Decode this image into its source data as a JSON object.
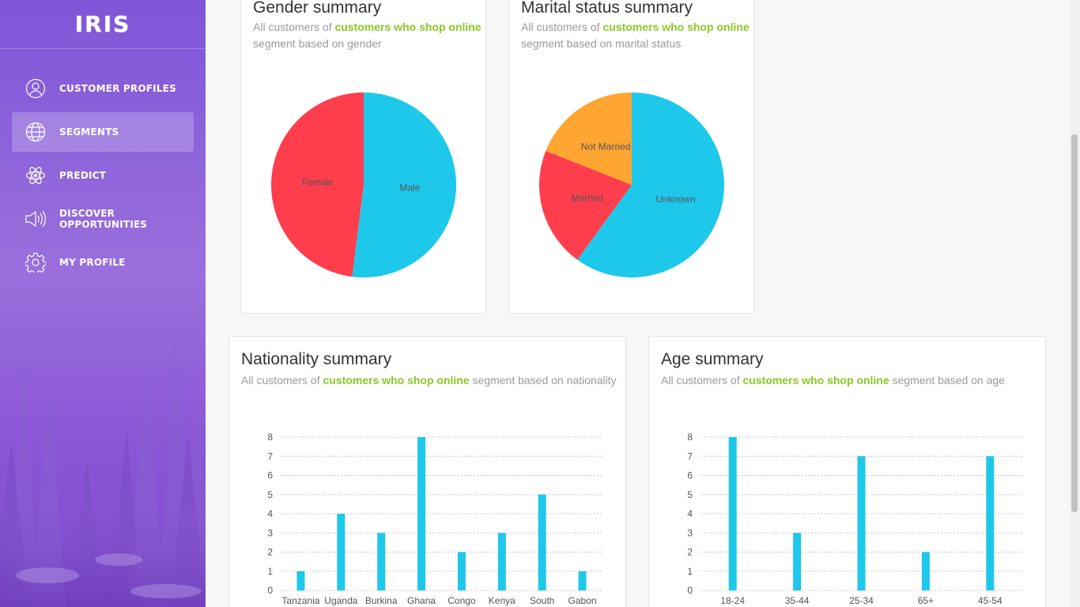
{
  "app": {
    "logo": "IRIS"
  },
  "sidebar": {
    "items": [
      {
        "label": "CUSTOMER PROFILES",
        "icon": "user-icon",
        "active": false
      },
      {
        "label": "SEGMENTS",
        "icon": "globe-icon",
        "active": true
      },
      {
        "label": "PREDICT",
        "icon": "atom-icon",
        "active": false
      },
      {
        "label": "DISCOVER OPPORTUNITIES",
        "icon": "speaker-icon",
        "active": false
      },
      {
        "label": "MY PROFILE",
        "icon": "gear-icon",
        "active": false
      }
    ]
  },
  "gender": {
    "title": "Gender summary",
    "sub_prefix": "All customers of",
    "segment": "customers who shop online",
    "sub_suffix": "segment based on gender"
  },
  "marital": {
    "title": "Marital status summary",
    "sub_prefix": "All customers of",
    "segment": "customers who shop online",
    "sub_suffix": "segment based on marital status"
  },
  "nationality": {
    "title": "Nationality summary",
    "sub_prefix": "All customers of",
    "segment": "customers who shop online",
    "sub_suffix": "segment based on nationality"
  },
  "age": {
    "title": "Age summary",
    "sub_prefix": "All customers of",
    "segment": "customers who shop online",
    "sub_suffix": "segment based on age"
  },
  "chart_data": [
    {
      "type": "pie",
      "categories": [
        "Male",
        "Female"
      ],
      "values": [
        52,
        48
      ],
      "colors": [
        "#1ec8ea",
        "#ff3e4d"
      ]
    },
    {
      "type": "pie",
      "categories": [
        "Unknown",
        "Married",
        "Not Married"
      ],
      "values": [
        60,
        21,
        19
      ],
      "colors": [
        "#1ec8ea",
        "#ff3e4d",
        "#ffa532"
      ]
    },
    {
      "type": "bar",
      "categories": [
        "Tanzania",
        "Uganda",
        "Burkina",
        "Ghana",
        "Congo",
        "Kenya",
        "South",
        "Gabon"
      ],
      "values": [
        1,
        4,
        3,
        8,
        2,
        3,
        5,
        1
      ],
      "ylim": [
        0,
        8
      ],
      "yticks": [
        0,
        1,
        2,
        3,
        4,
        5,
        6,
        7,
        8
      ],
      "color": "#1ec8ea",
      "grid": true
    },
    {
      "type": "bar",
      "categories": [
        "18-24",
        "35-44",
        "25-34",
        "65+",
        "45-54"
      ],
      "values": [
        8,
        3,
        7,
        2,
        7
      ],
      "ylim": [
        0,
        8
      ],
      "yticks": [
        0,
        1,
        2,
        3,
        4,
        5,
        6,
        7,
        8
      ],
      "color": "#1ec8ea",
      "grid": true
    }
  ]
}
